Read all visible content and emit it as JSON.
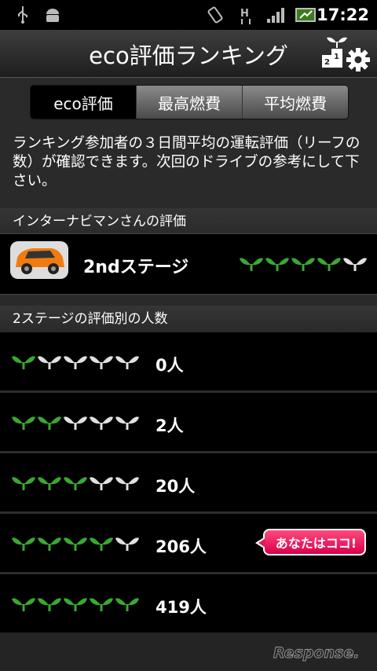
{
  "status_bar": {
    "time": "17:22",
    "icons": [
      "usb-icon",
      "android-debug-icon",
      "rotation-icon",
      "data-h-icon",
      "signal-icon",
      "battery-icon"
    ]
  },
  "header": {
    "title": "eco評価ランキング",
    "settings_icon": "ranking-settings-icon"
  },
  "tabs": [
    {
      "label": "eco評価",
      "active": true
    },
    {
      "label": "最高燃費",
      "active": false
    },
    {
      "label": "平均燃費",
      "active": false
    }
  ],
  "description": "ランキング参加者の３日間平均の運転評価（リーフの数）が確認できます。次回のドライブの参考にして下さい。",
  "user_section": {
    "header": "インターナビマンさんの評価",
    "stage": "2ndステージ",
    "leaves_green": 4,
    "leaves_total": 5
  },
  "distribution_section": {
    "header": "2ステージの評価別の人数",
    "rows": [
      {
        "leaves_green": 1,
        "count": "0人"
      },
      {
        "leaves_green": 2,
        "count": "2人"
      },
      {
        "leaves_green": 3,
        "count": "20人"
      },
      {
        "leaves_green": 4,
        "count": "206人",
        "badge": "あなたはココ!"
      },
      {
        "leaves_green": 5,
        "count": "419人"
      }
    ]
  },
  "watermark": "Response.",
  "colors": {
    "leaf_green": "#3aa832",
    "leaf_white": "#e0e0e0",
    "badge": "#e41a5e"
  }
}
